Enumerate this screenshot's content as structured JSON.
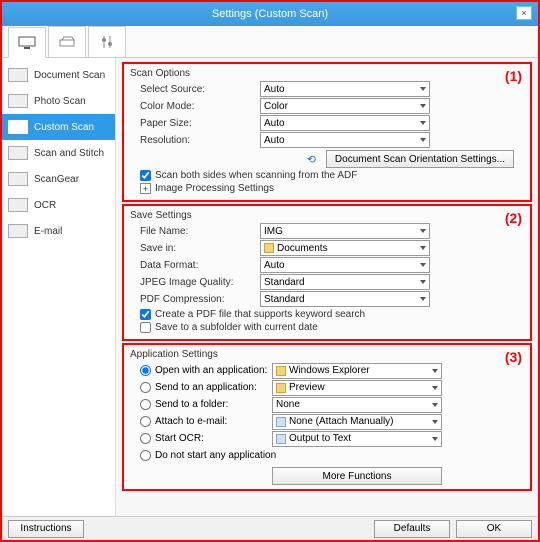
{
  "window": {
    "title": "Settings (Custom Scan)"
  },
  "toptabs": [
    "scanner",
    "platen",
    "tools"
  ],
  "sidebar": {
    "items": [
      {
        "label": "Document Scan"
      },
      {
        "label": "Photo Scan"
      },
      {
        "label": "Custom Scan"
      },
      {
        "label": "Scan and Stitch"
      },
      {
        "label": "ScanGear"
      },
      {
        "label": "OCR"
      },
      {
        "label": "E-mail"
      }
    ],
    "activeIndex": 2
  },
  "panel1": {
    "num": "(1)",
    "legend": "Scan Options",
    "rows": {
      "select_source": {
        "label": "Select Source:",
        "value": "Auto"
      },
      "color_mode": {
        "label": "Color Mode:",
        "value": "Color"
      },
      "paper_size": {
        "label": "Paper Size:",
        "value": "Auto"
      },
      "resolution": {
        "label": "Resolution:",
        "value": "Auto"
      }
    },
    "orient_btn": "Document Scan Orientation Settings...",
    "chk_both_sides": "Scan both sides when scanning from the ADF",
    "expander": "Image Processing Settings"
  },
  "panel2": {
    "num": "(2)",
    "legend": "Save Settings",
    "rows": {
      "file_name": {
        "label": "File Name:",
        "value": "IMG"
      },
      "save_in": {
        "label": "Save in:",
        "value": "Documents"
      },
      "data_format": {
        "label": "Data Format:",
        "value": "Auto"
      },
      "jpeg_q": {
        "label": "JPEG Image Quality:",
        "value": "Standard"
      },
      "pdf_comp": {
        "label": "PDF Compression:",
        "value": "Standard"
      }
    },
    "chk_pdf_keyword": "Create a PDF file that supports keyword search",
    "chk_subfolder": "Save to a subfolder with current date"
  },
  "panel3": {
    "num": "(3)",
    "legend": "Application Settings",
    "radios": {
      "open_app": {
        "label": "Open with an application:",
        "value": "Windows Explorer"
      },
      "send_app": {
        "label": "Send to an application:",
        "value": "Preview"
      },
      "send_folder": {
        "label": "Send to a folder:",
        "value": "None"
      },
      "attach_mail": {
        "label": "Attach to e-mail:",
        "value": "None (Attach Manually)"
      },
      "start_ocr": {
        "label": "Start OCR:",
        "value": "Output to Text"
      },
      "none": {
        "label": "Do not start any application"
      }
    },
    "more_fns": "More Functions"
  },
  "bottom": {
    "instructions": "Instructions",
    "defaults": "Defaults",
    "ok": "OK"
  }
}
